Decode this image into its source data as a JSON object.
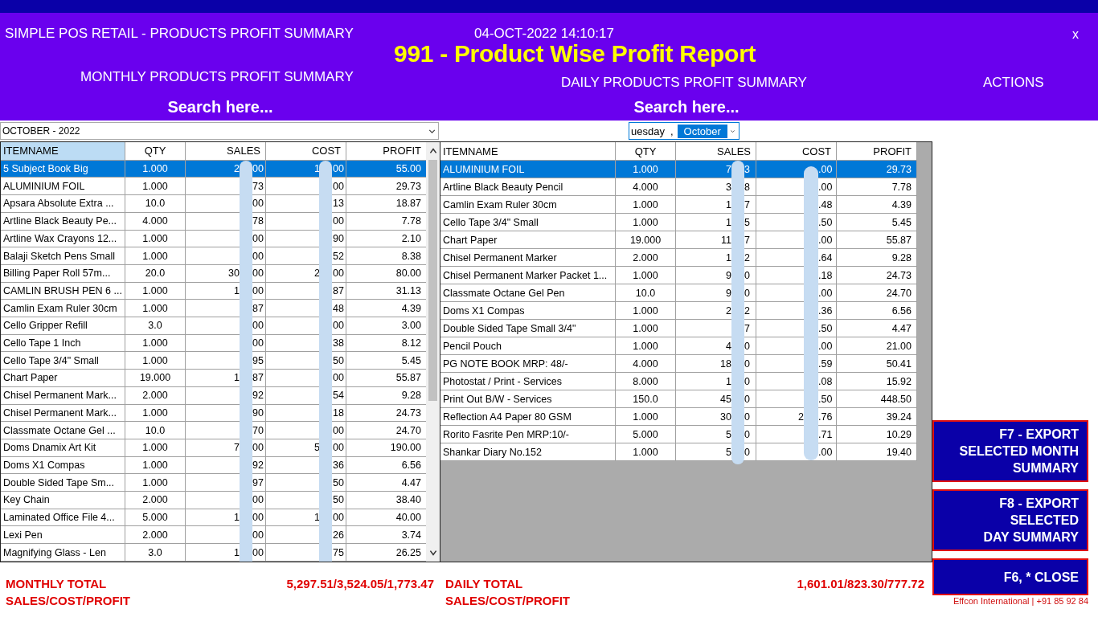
{
  "window": {
    "app_title": "SIMPLE POS RETAIL - PRODUCTS PROFIT SUMMARY",
    "datetime": "04-OCT-2022 14:10:17",
    "report_title": "991 - Product Wise Profit Report",
    "close": "x"
  },
  "sections": {
    "monthly": "MONTHLY PRODUCTS PROFIT SUMMARY",
    "daily": "DAILY PRODUCTS PROFIT SUMMARY",
    "actions": "ACTIONS"
  },
  "monthly": {
    "search_label": "Search here...",
    "period": "OCTOBER - 2022",
    "columns": [
      {
        "label": "ITEMNAME",
        "selected": true
      },
      {
        "label": "QTY",
        "selected": false
      },
      {
        "label": "SALES",
        "selected": false
      },
      {
        "label": "COST",
        "selected": false
      },
      {
        "label": "PROFIT",
        "selected": false
      }
    ],
    "rows": [
      {
        "item": "5 Subject Book Big",
        "qty": "1.000",
        "sales": {
          "lead": "2",
          "tail": "00"
        },
        "cost": {
          "lead": "1",
          "tail": "00"
        },
        "profit": "55.00",
        "selected": true
      },
      {
        "item": "ALUMINIUM FOIL",
        "qty": "1.000",
        "sales": {
          "tail": "73"
        },
        "cost": {
          "tail": "00"
        },
        "profit": "29.73",
        "selected": false
      },
      {
        "item": "Apsara Absolute Extra ...",
        "qty": "10.0",
        "sales": {
          "tail": "00"
        },
        "cost": {
          "tail": "13"
        },
        "profit": "18.87",
        "selected": false
      },
      {
        "item": "Artline Black Beauty Pe...",
        "qty": "4.000",
        "sales": {
          "tail": "78"
        },
        "cost": {
          "tail": "00"
        },
        "profit": "7.78",
        "selected": false
      },
      {
        "item": "Artline Wax Crayons 12...",
        "qty": "1.000",
        "sales": {
          "tail": "00"
        },
        "cost": {
          "tail": "90"
        },
        "profit": "2.10",
        "selected": false
      },
      {
        "item": "Balaji Sketch Pens Small",
        "qty": "1.000",
        "sales": {
          "tail": "00"
        },
        "cost": {
          "tail": "52"
        },
        "profit": "8.38",
        "selected": false
      },
      {
        "item": "Billing Paper Roll 57m...",
        "qty": "20.0",
        "sales": {
          "lead": "30",
          "tail": "00"
        },
        "cost": {
          "lead": "2",
          "tail": "00"
        },
        "profit": "80.00",
        "selected": false
      },
      {
        "item": "CAMLIN BRUSH PEN 6 ...",
        "qty": "1.000",
        "sales": {
          "lead": "1",
          "tail": "00"
        },
        "cost": {
          "tail": "87"
        },
        "profit": "31.13",
        "selected": false
      },
      {
        "item": "Camlin Exam Ruler 30cm",
        "qty": "1.000",
        "sales": {
          "tail": "87"
        },
        "cost": {
          "tail": "48"
        },
        "profit": "4.39",
        "selected": false
      },
      {
        "item": "Cello Gripper Refill",
        "qty": "3.0",
        "sales": {
          "tail": "00"
        },
        "cost": {
          "tail": "00"
        },
        "profit": "3.00",
        "selected": false
      },
      {
        "item": "Cello Tape 1 Inch",
        "qty": "1.000",
        "sales": {
          "tail": "00"
        },
        "cost": {
          "tail": "38"
        },
        "profit": "8.12",
        "selected": false
      },
      {
        "item": "Cello Tape 3/4\" Small",
        "qty": "1.000",
        "sales": {
          "tail": "95"
        },
        "cost": {
          "tail": "50"
        },
        "profit": "5.45",
        "selected": false
      },
      {
        "item": "Chart Paper",
        "qty": "19.000",
        "sales": {
          "lead": "1",
          "tail": "87"
        },
        "cost": {
          "tail": "00"
        },
        "profit": "55.87",
        "selected": false
      },
      {
        "item": "Chisel Permanent Mark...",
        "qty": "2.000",
        "sales": {
          "tail": "92"
        },
        "cost": {
          "tail": "54"
        },
        "profit": "9.28",
        "selected": false
      },
      {
        "item": "Chisel Permanent Mark...",
        "qty": "1.000",
        "sales": {
          "tail": "90"
        },
        "cost": {
          "tail": "18"
        },
        "profit": "24.73",
        "selected": false
      },
      {
        "item": "Classmate Octane Gel ...",
        "qty": "10.0",
        "sales": {
          "tail": "70"
        },
        "cost": {
          "tail": "00"
        },
        "profit": "24.70",
        "selected": false
      },
      {
        "item": "Doms Dnamix Art Kit",
        "qty": "1.000",
        "sales": {
          "lead": "7",
          "tail": "00"
        },
        "cost": {
          "lead": "5",
          "tail": "00"
        },
        "profit": "190.00",
        "selected": false
      },
      {
        "item": "Doms X1 Compas",
        "qty": "1.000",
        "sales": {
          "tail": "92"
        },
        "cost": {
          "tail": "36"
        },
        "profit": "6.56",
        "selected": false
      },
      {
        "item": "Double Sided Tape Sm...",
        "qty": "1.000",
        "sales": {
          "tail": "97"
        },
        "cost": {
          "tail": "50"
        },
        "profit": "4.47",
        "selected": false
      },
      {
        "item": "Key Chain",
        "qty": "2.000",
        "sales": {
          "tail": "00"
        },
        "cost": {
          "tail": "50"
        },
        "profit": "38.40",
        "selected": false
      },
      {
        "item": "Laminated Office File 4...",
        "qty": "5.000",
        "sales": {
          "lead": "1",
          "tail": "00"
        },
        "cost": {
          "lead": "1",
          "tail": "00"
        },
        "profit": "40.00",
        "selected": false
      },
      {
        "item": "Lexi Pen",
        "qty": "2.000",
        "sales": {
          "tail": "00"
        },
        "cost": {
          "tail": "26"
        },
        "profit": "3.74",
        "selected": false
      },
      {
        "item": "Magnifying Glass - Len",
        "qty": "3.0",
        "sales": {
          "lead": "1",
          "tail": "00"
        },
        "cost": {
          "tail": "75"
        },
        "profit": "26.25",
        "selected": false
      }
    ],
    "total_label": "MONTHLY TOTAL\nSALES/COST/PROFIT",
    "total": "5,297.51/3,524.05/1,773.47"
  },
  "daily": {
    "search_label": "Search here...",
    "date_picker": {
      "day": "uesday",
      "separator": ",",
      "month": "October",
      "month_selected": true
    },
    "columns": [
      {
        "label": "ITEMNAME",
        "selected": false
      },
      {
        "label": "QTY",
        "selected": false
      },
      {
        "label": "SALES",
        "selected": false
      },
      {
        "label": "COST",
        "selected": false
      },
      {
        "label": "PROFIT",
        "selected": false
      }
    ],
    "rows": [
      {
        "item": "ALUMINIUM FOIL",
        "qty": "1.000",
        "sales": {
          "lead": "7",
          "tail": "3"
        },
        "cost": {
          "tail": ".00"
        },
        "profit": "29.73",
        "selected": true
      },
      {
        "item": "Artline Black Beauty Pencil",
        "qty": "4.000",
        "sales": {
          "lead": "3",
          "tail": "8"
        },
        "cost": {
          "tail": ".00"
        },
        "profit": "7.78",
        "selected": false
      },
      {
        "item": "Camlin Exam Ruler 30cm",
        "qty": "1.000",
        "sales": {
          "lead": "1",
          "tail": "7"
        },
        "cost": {
          "tail": ".48"
        },
        "profit": "4.39",
        "selected": false
      },
      {
        "item": "Cello Tape 3/4\" Small",
        "qty": "1.000",
        "sales": {
          "lead": "1",
          "tail": "5"
        },
        "cost": {
          "tail": ".50"
        },
        "profit": "5.45",
        "selected": false
      },
      {
        "item": "Chart Paper",
        "qty": "19.000",
        "sales": {
          "lead": "11",
          "tail": "7"
        },
        "cost": {
          "tail": ".00"
        },
        "profit": "55.87",
        "selected": false
      },
      {
        "item": "Chisel Permanent Marker",
        "qty": "2.000",
        "sales": {
          "lead": "1",
          "tail": "2"
        },
        "cost": {
          "tail": ".64"
        },
        "profit": "9.28",
        "selected": false
      },
      {
        "item": "Chisel Permanent Marker Packet 1...",
        "qty": "1.000",
        "sales": {
          "lead": "9",
          "tail": "0"
        },
        "cost": {
          "tail": ".18"
        },
        "profit": "24.73",
        "selected": false
      },
      {
        "item": "Classmate Octane Gel Pen",
        "qty": "10.0",
        "sales": {
          "lead": "9",
          "tail": "0"
        },
        "cost": {
          "tail": ".00"
        },
        "profit": "24.70",
        "selected": false
      },
      {
        "item": "Doms X1 Compas",
        "qty": "1.000",
        "sales": {
          "lead": "2",
          "tail": "2"
        },
        "cost": {
          "tail": ".36"
        },
        "profit": "6.56",
        "selected": false
      },
      {
        "item": "Double Sided Tape Small 3/4\"",
        "qty": "1.000",
        "sales": {
          "tail": "7"
        },
        "cost": {
          "tail": ".50"
        },
        "profit": "4.47",
        "selected": false
      },
      {
        "item": "Pencil Pouch",
        "qty": "1.000",
        "sales": {
          "lead": "4",
          "tail": "0"
        },
        "cost": {
          "tail": ".00"
        },
        "profit": "21.00",
        "selected": false
      },
      {
        "item": "PG NOTE BOOK MRP: 48/-",
        "qty": "4.000",
        "sales": {
          "lead": "18",
          "tail": "0"
        },
        "cost": {
          "tail": ".59"
        },
        "profit": "50.41",
        "selected": false
      },
      {
        "item": "Photostat / Print - Services",
        "qty": "8.000",
        "sales": {
          "lead": "1",
          "tail": "0"
        },
        "cost": {
          "tail": ".08"
        },
        "profit": "15.92",
        "selected": false
      },
      {
        "item": "Print Out B/W - Services",
        "qty": "150.0",
        "sales": {
          "lead": "45",
          "tail": "0"
        },
        "cost": {
          "tail": ".50"
        },
        "profit": "448.50",
        "selected": false
      },
      {
        "item": "Reflection A4 Paper 80 GSM",
        "qty": "1.000",
        "sales": {
          "lead": "30",
          "tail": "0"
        },
        "cost": {
          "lead": "2",
          "tail": ".76"
        },
        "profit": "39.24",
        "selected": false
      },
      {
        "item": "Rorito Fasrite Pen MRP:10/-",
        "qty": "5.000",
        "sales": {
          "lead": "5",
          "tail": "0"
        },
        "cost": {
          "tail": ".71"
        },
        "profit": "10.29",
        "selected": false
      },
      {
        "item": "Shankar Diary No.152",
        "qty": "1.000",
        "sales": {
          "lead": "5",
          "tail": "0"
        },
        "cost": {
          "tail": ".00"
        },
        "profit": "19.40",
        "selected": false
      }
    ],
    "total_label": "DAILY TOTAL\nSALES/COST/PROFIT",
    "total": "1,601.01/823.30/777.72"
  },
  "buttons": [
    {
      "label": "F7 - EXPORT\nSELECTED MONTH\nSUMMARY",
      "kind": "tall"
    },
    {
      "label": "F8 - EXPORT\nSELECTED\nDAY SUMMARY",
      "kind": "tall"
    },
    {
      "label": "F6, * CLOSE",
      "kind": "short"
    }
  ],
  "credit": "Effcon International | +91 85 92 84"
}
